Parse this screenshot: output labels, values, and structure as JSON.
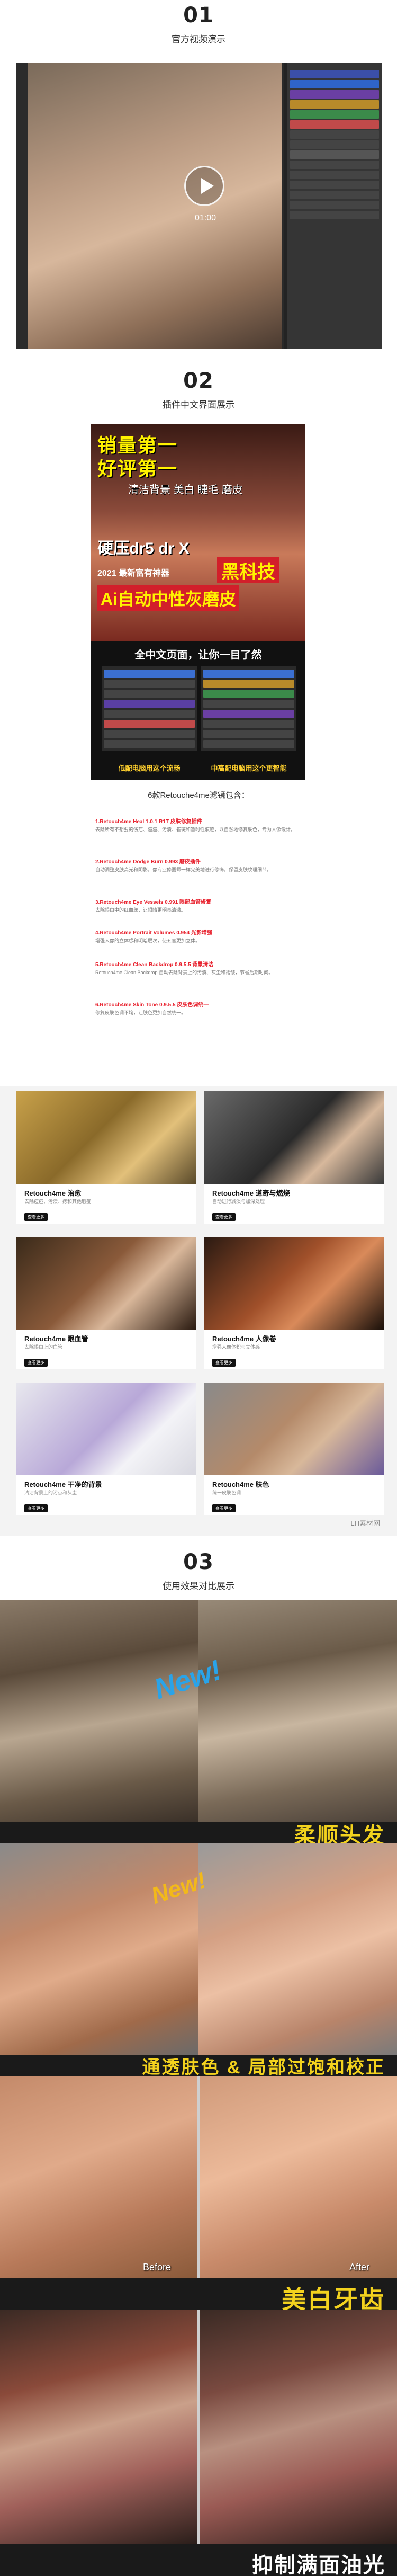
{
  "sections": [
    {
      "number": "01",
      "title": "官方视频演示"
    },
    {
      "number": "02",
      "title": "插件中文界面展示"
    },
    {
      "number": "03",
      "title": "使用效果对比展示"
    }
  ],
  "video": {
    "duration": "01:00"
  },
  "poster": {
    "line1": "销量第一",
    "line2": "好评第一",
    "features": "清洁背景 美白 睫毛 磨皮",
    "brand": "硬压dr5 dr X",
    "subtitle": "2021 最新富有神器",
    "highlight1": "黑科技",
    "highlight2": "Ai自动中性灰磨皮",
    "menu_title": "全中文页面，让你一目了然",
    "caption_left": "低配电脑用这个流畅",
    "caption_right": "中高配电脑用这个更智能"
  },
  "filters": {
    "heading": "6款Retouche4me滤镜包含：",
    "items": [
      {
        "title": "1.Retouch4me Heal 1.0.1 R1T 皮肤修复插件",
        "desc": "去除所有不想要的伤疤、痘痘、污渍、雀斑和暂时性痕迹，以自然地修复肤色，专为人像设计。"
      },
      {
        "title": "2.Retouch4me Dodge Burn 0.993 磨皮插件",
        "desc": "自动调整皮肤高光和阴影，像专业修图师一样完美地进行修饰，保留皮肤纹理细节。"
      },
      {
        "title": "3.Retouch4me Eye Vessels 0.991 眼部血管修复",
        "desc": "去除眼白中的红血丝，让眼睛更明亮清澈。"
      },
      {
        "title": "4.Retouch4me Portrait Volumes 0.954 光影增强",
        "desc": "增强人像的立体感和明暗层次，使五官更加立体。"
      },
      {
        "title": "5.Retouch4me Clean Backdrop 0.9.5.5 背景清洁",
        "desc": "Retouch4me Clean Backdrop 自动去除背景上的污渍、灰尘和褶皱，节省后期时间。"
      },
      {
        "title": "6.Retouch4me Skin Tone 0.9.5.5 皮肤色调统一",
        "desc": "修复皮肤色调不均，让肤色更加自然统一。"
      }
    ]
  },
  "cards": [
    {
      "title": "Retouch4me 治愈",
      "desc": "去除痘痘、污渍、痣和其他瑕疵",
      "button": "查看更多"
    },
    {
      "title": "Retouch4me 道奇与燃烧",
      "desc": "自动进行减淡与加深处理",
      "button": "查看更多"
    },
    {
      "title": "Retouch4me 眼血管",
      "desc": "去除眼白上的血管",
      "button": "查看更多"
    },
    {
      "title": "Retouch4me 人像卷",
      "desc": "增强人像体积与立体感",
      "button": "查看更多"
    },
    {
      "title": "Retouch4me 干净的背景",
      "desc": "清洁背景上的污点和灰尘",
      "button": "查看更多"
    },
    {
      "title": "Retouch4me 肤色",
      "desc": "统一皮肤色调",
      "button": "查看更多"
    }
  ],
  "watermark": "LH素材网",
  "comparisons": [
    {
      "caption": "柔顺头发",
      "badge": "New!"
    },
    {
      "caption": "通透肤色 & 局部过饱和校正",
      "badge": "New!"
    },
    {
      "caption": "美白牙齿",
      "before_label": "Before",
      "after_label": "After"
    },
    {
      "caption": "抑制满面油光"
    }
  ],
  "colors": {
    "accent_red": "#e8232f",
    "caption_yellow": "#f3d21e",
    "dark_bar": "#1a1a1a"
  }
}
